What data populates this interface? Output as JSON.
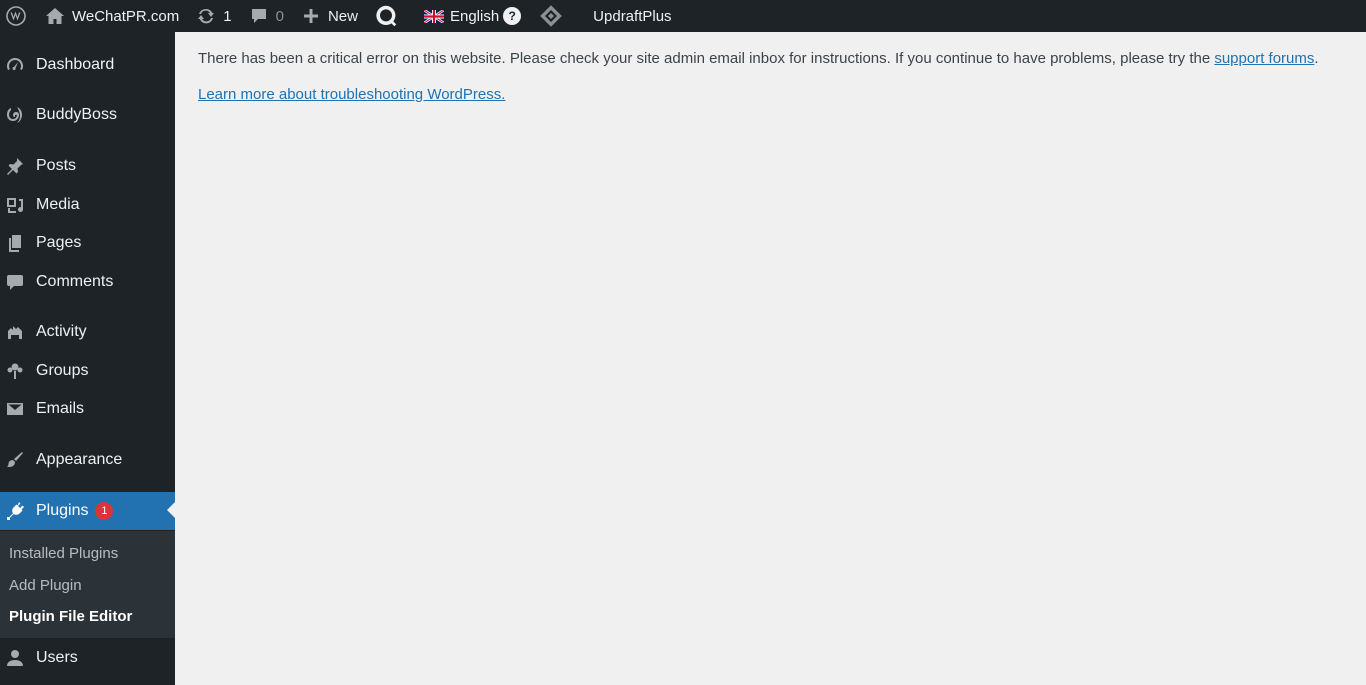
{
  "adminbar": {
    "site_name": "WeChatPR.com",
    "updates_count": "1",
    "comments_count": "0",
    "new_label": "New",
    "language_label": "English",
    "help_label": "?",
    "updraft_label": "UpdraftPlus"
  },
  "sidebar": {
    "items": {
      "dashboard": "Dashboard",
      "buddyboss": "BuddyBoss",
      "posts": "Posts",
      "media": "Media",
      "pages": "Pages",
      "comments": "Comments",
      "activity": "Activity",
      "groups": "Groups",
      "emails": "Emails",
      "appearance": "Appearance",
      "plugins": "Plugins",
      "users": "Users"
    },
    "plugins_badge": "1",
    "submenu": {
      "installed": "Installed Plugins",
      "add": "Add Plugin",
      "editor": "Plugin File Editor"
    }
  },
  "main": {
    "error_text": "There has been a critical error on this website. Please check your site admin email inbox for instructions. If you continue to have problems, please try the ",
    "support_link": "support forums",
    "error_end": ".",
    "learn_link": "Learn more about troubleshooting WordPress."
  },
  "colors": {
    "adminbar_bg": "#1d2327",
    "accent": "#2271b1",
    "badge": "#d63638",
    "content_bg": "#f0f0f1"
  }
}
